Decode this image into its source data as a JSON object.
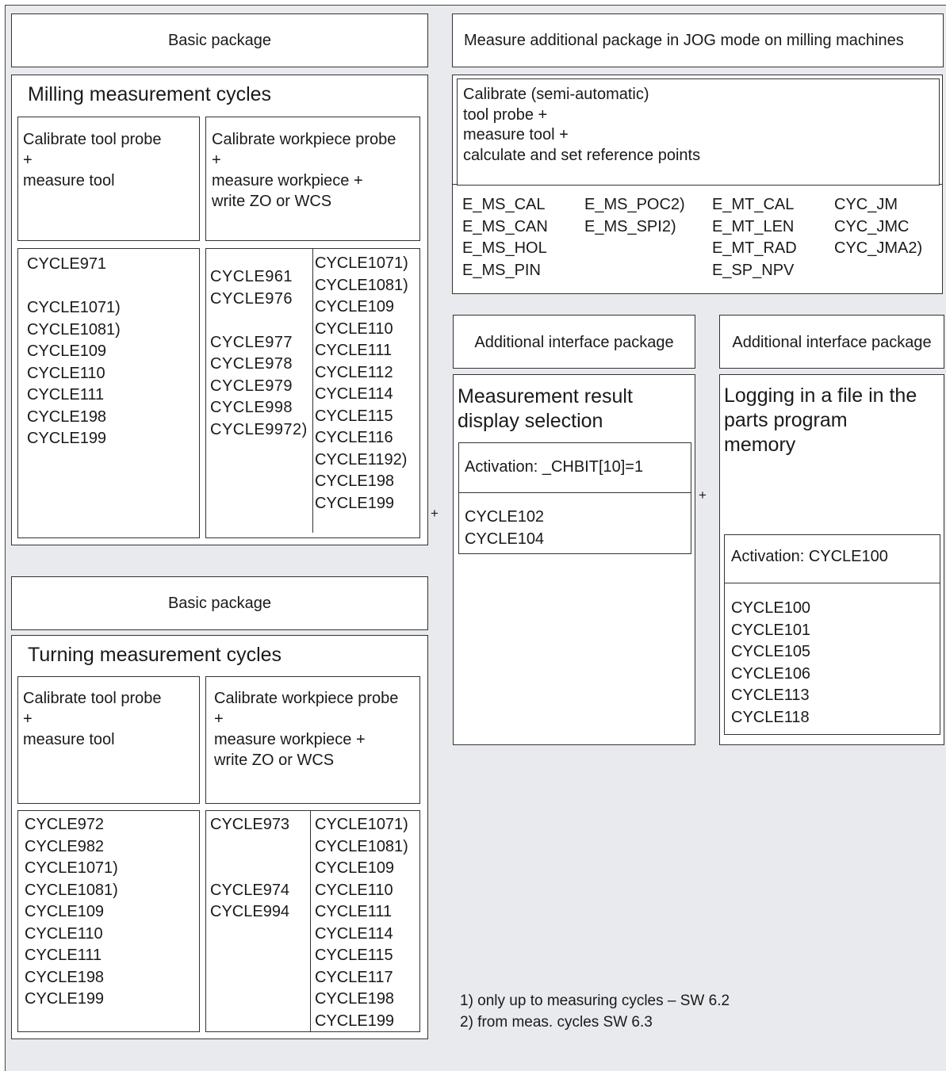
{
  "milling": {
    "header": "Basic package",
    "title": "Milling measurement cycles",
    "tool_probe": [
      "Calibrate tool probe",
      "+",
      "measure tool"
    ],
    "workpiece_probe": [
      "Calibrate workpiece probe",
      "+",
      "measure workpiece +",
      "write ZO or WCS"
    ],
    "tool_cycles": [
      "CYCLE971",
      "",
      "CYCLE1071)",
      "CYCLE1081)",
      "CYCLE109",
      "CYCLE110",
      "CYCLE111",
      "CYCLE198",
      "CYCLE199"
    ],
    "wp_cycles_a": [
      "CYCLE961",
      "CYCLE976",
      "",
      "CYCLE977",
      "CYCLE978",
      "CYCLE979",
      "CYCLE998",
      "CYCLE9972)"
    ],
    "wp_cycles_b": [
      "CYCLE1071)",
      "CYCLE1081)",
      "CYCLE109",
      "CYCLE110",
      "CYCLE111",
      "CYCLE112",
      "CYCLE114",
      "CYCLE115",
      "CYCLE116",
      "CYCLE1192)",
      "CYCLE198",
      "CYCLE199"
    ]
  },
  "jog": {
    "header": "Measure additional package in JOG mode on milling machines",
    "desc": [
      "Calibrate (semi-automatic)",
      "tool probe +",
      "measure tool +",
      "calculate and set reference points"
    ],
    "col1": [
      "E_MS_CAL",
      "E_MS_CAN",
      "E_MS_HOL",
      "E_MS_PIN"
    ],
    "col2": [
      "E_MS_POC2)",
      "E_MS_SPI2)"
    ],
    "col3": [
      "E_MT_CAL",
      "E_MT_LEN",
      "E_MT_RAD",
      "E_SP_NPV"
    ],
    "col4": [
      "CYC_JM",
      "CYC_JMC",
      "CYC_JMA2)"
    ]
  },
  "display": {
    "header": "Additional interface package",
    "title": [
      "Measurement result",
      "display selection"
    ],
    "activation": "Activation: _CHBIT[10]=1",
    "cycles": [
      "CYCLE102",
      "CYCLE104"
    ]
  },
  "logging": {
    "header": "Additional interface package",
    "title": [
      "Logging in a file in the",
      "parts program",
      "memory"
    ],
    "activation": "Activation: CYCLE100",
    "cycles": [
      "CYCLE100",
      "CYCLE101",
      "CYCLE105",
      "CYCLE106",
      "CYCLE113",
      "CYCLE118"
    ]
  },
  "turning": {
    "header": "Basic package",
    "title": "Turning measurement cycles",
    "tool_probe": [
      "Calibrate tool probe",
      "+",
      "measure tool"
    ],
    "workpiece_probe": [
      "Calibrate workpiece probe",
      "+",
      "measure workpiece +",
      "write ZO or WCS"
    ],
    "tool_cycles": [
      "CYCLE972",
      "CYCLE982",
      "CYCLE1071)",
      "CYCLE1081)",
      "CYCLE109",
      "CYCLE110",
      "CYCLE111",
      "CYCLE198",
      "CYCLE199"
    ],
    "wp_cycles_a": [
      "CYCLE973",
      "",
      "",
      "CYCLE974",
      "CYCLE994"
    ],
    "wp_cycles_b": [
      "CYCLE1071)",
      "CYCLE1081)",
      "CYCLE109",
      "CYCLE110",
      "CYCLE111",
      "CYCLE114",
      "CYCLE115",
      "CYCLE117",
      "CYCLE198",
      "CYCLE199"
    ]
  },
  "plus_sign": "+",
  "footnotes": [
    "1) only up to measuring cycles – SW 6.2",
    "2) from meas. cycles SW 6.3"
  ]
}
